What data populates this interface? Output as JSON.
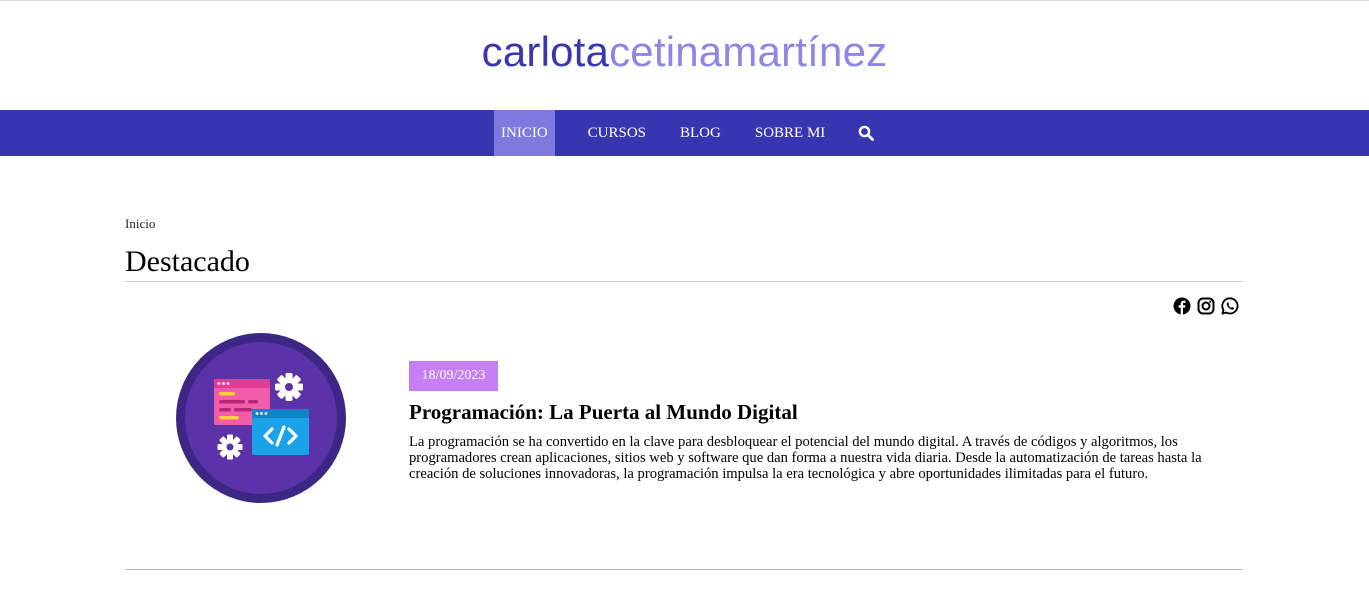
{
  "site": {
    "logo_part1": "carlota",
    "logo_part2": "cetinamartínez",
    "accent_color": "#3736b0",
    "accent_light": "#8c86e6",
    "badge_color": "#c57ef3"
  },
  "nav": {
    "items": [
      {
        "label": "INICIO",
        "active": true
      },
      {
        "label": "CURSOS",
        "active": false
      },
      {
        "label": "BLOG",
        "active": false
      },
      {
        "label": "SOBRE MI",
        "active": false
      }
    ],
    "search_icon": "search-icon"
  },
  "breadcrumb": "Inicio",
  "heading": "Destacado",
  "social": [
    "facebook-icon",
    "instagram-icon",
    "whatsapp-icon"
  ],
  "post": {
    "date": "18/09/2023",
    "title": "Programación: La Puerta al Mundo Digital",
    "excerpt": "La programación se ha convertido en la clave para desbloquear el potencial del mundo digital. A través de códigos y algoritmos, los programadores crean aplicaciones, sitios web y software que dan forma a nuestra vida diaria. Desde la automatización de tareas hasta la creación de soluciones innovadoras, la programación impulsa la era tecnológica y abre oportunidades ilimitadas para el futuro.",
    "image_icon": "programming-illustration"
  }
}
